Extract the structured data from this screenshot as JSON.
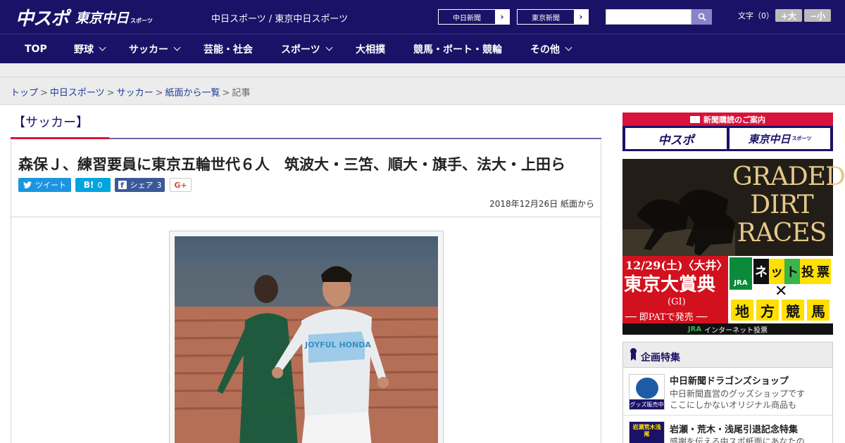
{
  "header": {
    "logo_main": "中スポ",
    "logo_sub": "東京中日",
    "logo_sub_small": "スポーツ",
    "site_title": "中日スポーツ / 東京中日スポーツ",
    "paper_links": [
      "中日新聞",
      "東京新聞"
    ],
    "arrow": "›",
    "font_size_label": "文字（0）",
    "font_larger": "+大",
    "font_smaller": "−小"
  },
  "nav": {
    "items": [
      {
        "label": "TOP",
        "has_menu": false
      },
      {
        "label": "野球",
        "has_menu": true
      },
      {
        "label": "サッカー",
        "has_menu": true
      },
      {
        "label": "芸能・社会",
        "has_menu": false
      },
      {
        "label": "スポーツ",
        "has_menu": true
      },
      {
        "label": "大相撲",
        "has_menu": false
      },
      {
        "label": "競馬・ボート・競輪",
        "has_menu": false
      },
      {
        "label": "その他",
        "has_menu": true
      }
    ]
  },
  "breadcrumb": {
    "items": [
      "トップ",
      "中日スポーツ",
      "サッカー",
      "紙面から一覧"
    ],
    "current": "記事",
    "separator": ">"
  },
  "article": {
    "category": "【サッカー】",
    "headline": "森保Ｊ、練習要員に東京五輪世代６人　筑波大・三笘、順大・旗手、法大・上田ら",
    "share": {
      "tweet": "ツイート",
      "hatena_label": "B!",
      "hatena_count": "0",
      "facebook": "シェア",
      "facebook_count": "3",
      "gplus": "G+"
    },
    "date": "2018年12月26日 紙面から",
    "photo_shirt_text": "JOYFUL HONDA"
  },
  "sidebar": {
    "subscription_label": "新聞購読のご案内",
    "subscription_buttons": [
      "中スポ",
      "東京中日"
    ],
    "subscription_small": "スポーツ",
    "ad": {
      "headline_lines": [
        "GRADED",
        "DIRT",
        "RACES"
      ],
      "date": "12/29(土)〈大井〉",
      "race": "東京大賞典",
      "grade": "(GI)",
      "pat": "── 即PATで発売 ──",
      "net_tiles": [
        "ネ",
        "ッ",
        "ト",
        "投",
        "票"
      ],
      "local_tiles": [
        "地",
        "方",
        "競",
        "馬"
      ],
      "jra": "JRA",
      "bottom": "インターネット投票"
    },
    "features_title": "企画特集",
    "features": [
      {
        "title": "中日新聞ドラゴンズショップ",
        "desc": [
          "中日新聞直営のグッズショップです",
          "ここにしかないオリジナル商品も"
        ],
        "thumb_label": "グッズ販売中"
      },
      {
        "title": "岩瀬・荒木・浅尾引退記念特集",
        "desc": [
          "感謝を伝える中スポ紙面にあなたの"
        ],
        "thumb_label": "岩瀬荒木浅尾"
      }
    ]
  },
  "colors": {
    "header_bg": "#1a1266",
    "accent_red": "#e2123b",
    "link_blue": "#1a3c99",
    "twitter": "#1b95e0",
    "hatena": "#00a4de",
    "facebook": "#3b5998",
    "gplus": "#dd4b39"
  }
}
